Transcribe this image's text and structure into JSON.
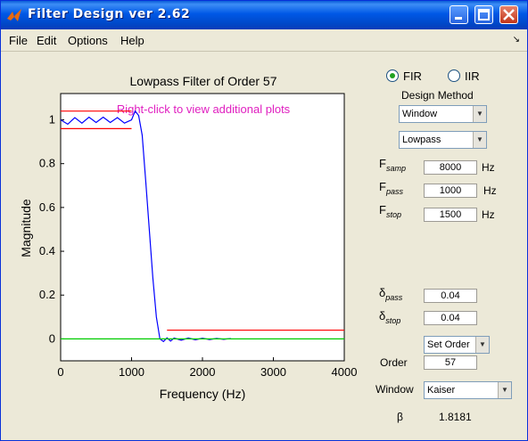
{
  "window": {
    "title": "Filter Design ver 2.62"
  },
  "menu": {
    "items": [
      "File",
      "Edit",
      "Options",
      "Help"
    ]
  },
  "plot": {
    "title": "Lowpass Filter of Order 57",
    "hint": "Right-click to view additional plots",
    "xlabel": "Frequency (Hz)",
    "ylabel": "Magnitude",
    "xticks": [
      "0",
      "1000",
      "2000",
      "3000",
      "4000"
    ],
    "yticks": [
      "0",
      "0.2",
      "0.4",
      "0.6",
      "0.8",
      "1"
    ]
  },
  "chart_data": {
    "type": "line",
    "title": "Lowpass Filter of Order 57",
    "xlabel": "Frequency (Hz)",
    "ylabel": "Magnitude",
    "xlim": [
      0,
      4000
    ],
    "ylim": [
      -0.1,
      1.12
    ],
    "series": [
      {
        "color": "#0000ff",
        "x": [
          0,
          100,
          200,
          300,
          400,
          500,
          600,
          700,
          800,
          900,
          1000,
          1050,
          1100,
          1150,
          1200,
          1250,
          1300,
          1350,
          1400,
          1450,
          1500,
          1550,
          1600,
          1700,
          1800,
          1900,
          2000,
          2100,
          2200,
          2300,
          2400
        ],
        "y": [
          1.0,
          0.98,
          1.01,
          0.985,
          1.012,
          0.988,
          1.012,
          0.988,
          1.01,
          0.985,
          1.0,
          1.04,
          1.02,
          0.93,
          0.72,
          0.5,
          0.28,
          0.1,
          0.0,
          -0.012,
          0.005,
          -0.01,
          0.004,
          -0.006,
          0.004,
          -0.004,
          0.003,
          -0.003,
          0.002,
          -0.002,
          0.002
        ]
      },
      {
        "color": "#ff0000",
        "x": [
          0,
          1000
        ],
        "y": [
          1.04,
          1.04
        ]
      },
      {
        "color": "#ff0000",
        "x": [
          0,
          1000
        ],
        "y": [
          0.96,
          0.96
        ]
      },
      {
        "color": "#ff0000",
        "x": [
          1500,
          4000
        ],
        "y": [
          0.04,
          0.04
        ]
      },
      {
        "color": "#00cc00",
        "x": [
          0,
          4000
        ],
        "y": [
          0,
          0
        ]
      }
    ],
    "grid": false
  },
  "controls": {
    "fir_label": "FIR",
    "iir_label": "IIR",
    "design_method_label": "Design Method",
    "method_value": "Window",
    "type_value": "Lowpass",
    "fsamp_label": "F",
    "fsamp_sub": "samp",
    "fsamp_value": "8000",
    "fsamp_unit": "Hz",
    "fpass_label": "F",
    "fpass_sub": "pass",
    "fpass_value": "1000",
    "fpass_unit": "Hz",
    "fstop_label": "F",
    "fstop_sub": "stop",
    "fstop_value": "1500",
    "fstop_unit": "Hz",
    "dpass_label": "δ",
    "dpass_sub": "pass",
    "dpass_value": "0.04",
    "dstop_label": "δ",
    "dstop_sub": "stop",
    "dstop_value": "0.04",
    "order_mode_value": "Set Order",
    "order_label": "Order",
    "order_value": "57",
    "window_label": "Window",
    "window_value": "Kaiser",
    "beta_label": "β",
    "beta_value": "1.8181"
  }
}
